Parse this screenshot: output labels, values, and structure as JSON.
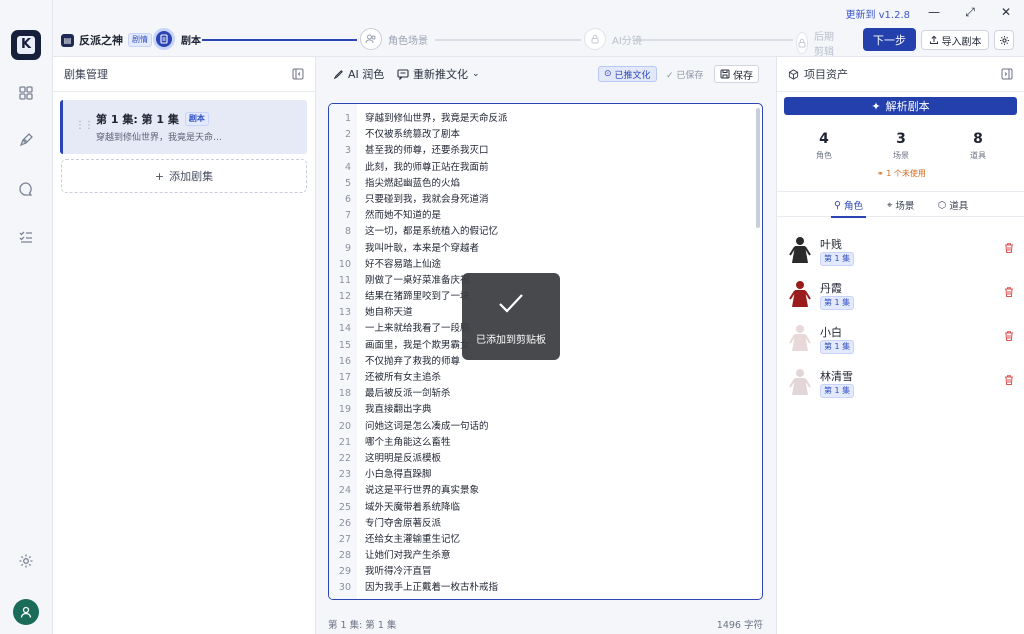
{
  "app": {
    "update_label": "更新到 v1.2.8",
    "project_name": "反派之神",
    "project_tag": "剧情"
  },
  "steps": [
    {
      "label": "剧本",
      "state": "active"
    },
    {
      "label": "角色场景",
      "state": "pending"
    },
    {
      "label": "AI分镜",
      "state": "disabled"
    },
    {
      "label": "后期剪辑",
      "state": "disabled"
    }
  ],
  "toolbar": {
    "next_label": "下一步",
    "import_label": "导入剧本"
  },
  "episodes": {
    "title": "剧集管理",
    "items": [
      {
        "title": "第 1 集: 第 1 集",
        "tag": "剧本",
        "preview": "穿越到修仙世界，我竟是天命…"
      }
    ],
    "add_label": "添加剧集"
  },
  "editor": {
    "polish_label": "AI 润色",
    "rewrite_label": "重新推文化",
    "rewritten_label": "已推文化",
    "saved_label": "已保存",
    "save_label": "保存",
    "footer_episode": "第 1 集: 第 1 集",
    "footer_count": "1496 字符",
    "lines": [
      "穿越到修仙世界，我竟是天命反派",
      "不仅被系统篡改了剧本",
      "甚至我的师尊，还要杀我灭口",
      "此刻，我的师尊正站在我面前",
      "指尖燃起幽蓝色的火焰",
      "只要碰到我，我就会身死道消",
      "然而她不知道的是",
      "这一切，都是系统植入的假记忆",
      "我叫叶耿，本来是个穿越者",
      "好不容易踏上仙途",
      "刚做了一桌好菜准备庆祝",
      "结果在猪蹄里咬到了一块",
      "她自称天道",
      "一上来就给我看了一段剧",
      "画面里，我是个欺男霸女",
      "不仅抛弃了救我的师尊",
      "还被所有女主追杀",
      "最后被反派一剑斩杀",
      "我直接翻出字典",
      "问她这词是怎么凑成一句话的",
      "哪个主角能这么畜牲",
      "这明明是反派模板",
      "小白急得直跺脚",
      "说这是平行世界的真实景象",
      "域外天魔带着系统降临",
      "专门夺舍原著反派",
      "还给女主灌输重生记忆",
      "让她们对我产生杀意",
      "我听得冷汗直冒",
      "因为我手上正戴着一枚古朴戒指"
    ],
    "toast": "已添加到剪贴板"
  },
  "assets": {
    "title": "项目资产",
    "parse_label": "解析剧本",
    "stats": [
      {
        "value": "4",
        "label": "角色"
      },
      {
        "value": "3",
        "label": "场景"
      },
      {
        "value": "8",
        "label": "道具"
      }
    ],
    "unused_label": "1 个未使用",
    "tabs": [
      "角色",
      "场景",
      "道具"
    ],
    "characters": [
      {
        "name": "叶贱",
        "episode": "第 1 集",
        "color": "#2a2a2a"
      },
      {
        "name": "丹霞",
        "episode": "第 1 集",
        "color": "#9b1c1c"
      },
      {
        "name": "小白",
        "episode": "第 1 集",
        "color": "#e8d8d8"
      },
      {
        "name": "林清雪",
        "episode": "第 1 集",
        "color": "#e2d6d6"
      }
    ]
  }
}
